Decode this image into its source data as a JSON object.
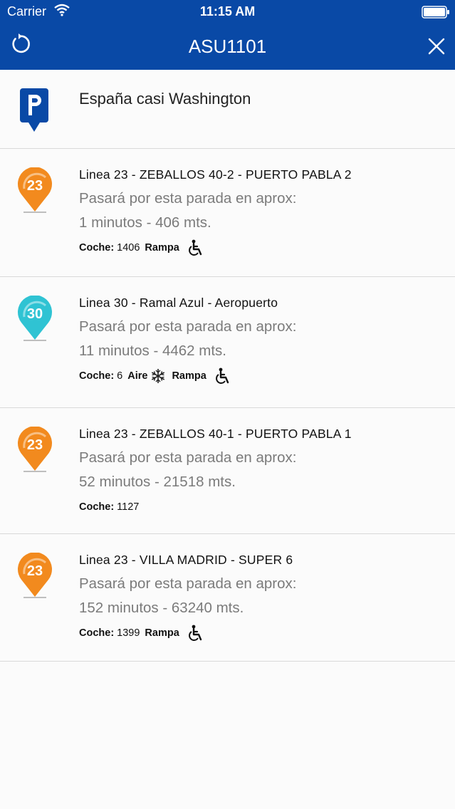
{
  "status": {
    "carrier": "Carrier",
    "time": "11:15 AM"
  },
  "header": {
    "title": "ASU1101",
    "refresh_icon": "refresh-icon",
    "close_icon": "close-icon"
  },
  "stop": {
    "name": "España casi Washington",
    "icon": "parking-stop-icon"
  },
  "buses": [
    {
      "badge": "23",
      "color": "#f28a1e",
      "title": "Linea 23 - ZEBALLOS 40-2 - PUERTO PABLA 2",
      "info": "Pasará por esta parada en aprox:",
      "eta": "1 minutos - 406 mts.",
      "coche_label": "Coche:",
      "coche": "1406",
      "rampa": "Rampa"
    },
    {
      "badge": "30",
      "color": "#2fc3d3",
      "title": "Linea 30 - Ramal Azul - Aeropuerto",
      "info": "Pasará por esta parada en aprox:",
      "eta": "11 minutos - 4462 mts.",
      "coche_label": "Coche:",
      "coche": "6",
      "aire": "Aire",
      "rampa": "Rampa"
    },
    {
      "badge": "23",
      "color": "#f28a1e",
      "title": "Linea 23 - ZEBALLOS 40-1 - PUERTO PABLA 1",
      "info": "Pasará por esta parada en aprox:",
      "eta": "52 minutos - 21518 mts.",
      "coche_label": "Coche:",
      "coche": "1127"
    },
    {
      "badge": "23",
      "color": "#f28a1e",
      "title": "Linea 23 - VILLA MADRID - SUPER 6",
      "info": "Pasará por esta parada en aprox:",
      "eta": "152 minutos - 63240 mts.",
      "coche_label": "Coche:",
      "coche": "1399",
      "rampa": "Rampa"
    }
  ]
}
